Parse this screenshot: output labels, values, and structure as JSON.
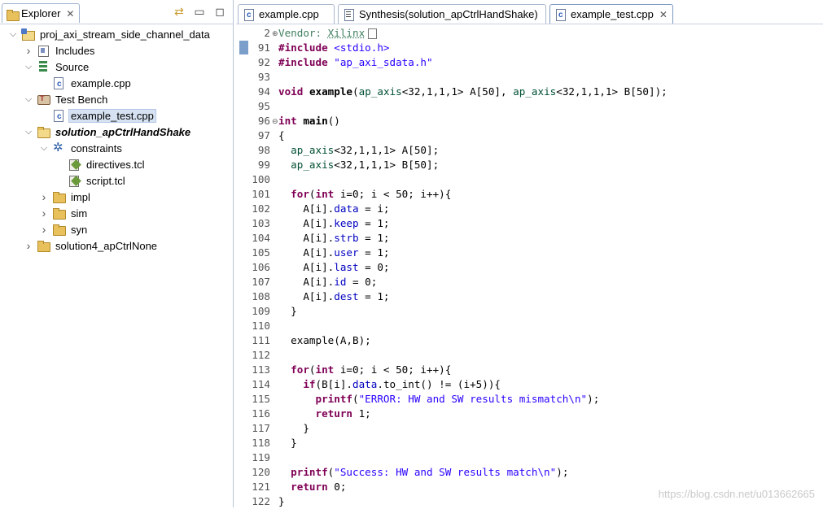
{
  "explorer": {
    "tab_label": "Explorer",
    "tree": [
      {
        "label": "proj_axi_stream_side_channel_data",
        "icon": "project-icon",
        "depth": 0,
        "expanded": true
      },
      {
        "label": "Includes",
        "icon": "includes-icon",
        "depth": 1,
        "expanded": false
      },
      {
        "label": "Source",
        "icon": "source-icon",
        "depth": 1,
        "expanded": true
      },
      {
        "label": "example.cpp",
        "icon": "cpp-file-icon",
        "depth": 2
      },
      {
        "label": "Test Bench",
        "icon": "test-bench-icon",
        "depth": 1,
        "expanded": true
      },
      {
        "label": "example_test.cpp",
        "icon": "cpp-file-icon",
        "depth": 2,
        "selected": true
      },
      {
        "label": "solution_apCtrlHandShake",
        "icon": "folder-icon",
        "depth": 1,
        "expanded": true,
        "active": true
      },
      {
        "label": "constraints",
        "icon": "gear-icon",
        "depth": 2,
        "expanded": true
      },
      {
        "label": "directives.tcl",
        "icon": "tcl-script-icon",
        "depth": 3
      },
      {
        "label": "script.tcl",
        "icon": "tcl-script-icon",
        "depth": 3
      },
      {
        "label": "impl",
        "icon": "folder-icon",
        "depth": 2,
        "expanded": false
      },
      {
        "label": "sim",
        "icon": "folder-icon",
        "depth": 2,
        "expanded": false
      },
      {
        "label": "syn",
        "icon": "folder-icon",
        "depth": 2,
        "expanded": false
      },
      {
        "label": "solution4_apCtrlNone",
        "icon": "folder-icon",
        "depth": 1,
        "expanded": false
      }
    ]
  },
  "editor": {
    "tabs": [
      {
        "label": "example.cpp",
        "icon": "cpp-file-icon",
        "active": false
      },
      {
        "label": "Synthesis(solution_apCtrlHandShake)",
        "icon": "report-icon",
        "active": false
      },
      {
        "label": "example_test.cpp",
        "icon": "cpp-file-icon",
        "active": true
      }
    ],
    "lines": [
      {
        "n": "2",
        "fold": "⊕",
        "tokens": [
          [
            "cmt",
            "Vendor: "
          ],
          [
            "cmt ref",
            "Xilinx"
          ]
        ],
        "box": true
      },
      {
        "n": "91",
        "tokens": [
          [
            "pp",
            "#include"
          ],
          [
            "",
            " "
          ],
          [
            "str",
            "<stdio.h>"
          ]
        ]
      },
      {
        "n": "92",
        "tokens": [
          [
            "pp",
            "#include"
          ],
          [
            "",
            " "
          ],
          [
            "str",
            "\"ap_axi_sdata.h\""
          ]
        ]
      },
      {
        "n": "93",
        "tokens": []
      },
      {
        "n": "94",
        "tokens": [
          [
            "kw",
            "void"
          ],
          [
            "",
            " "
          ],
          [
            "fn",
            "example"
          ],
          [
            "",
            "("
          ],
          [
            "ty",
            "ap_axis"
          ],
          [
            "",
            "<32,1,1,1> A[50], "
          ],
          [
            "ty",
            "ap_axis"
          ],
          [
            "",
            "<32,1,1,1> B[50]);"
          ]
        ]
      },
      {
        "n": "95",
        "tokens": []
      },
      {
        "n": "96",
        "fold": "⊖",
        "tokens": [
          [
            "kw",
            "int"
          ],
          [
            "",
            " "
          ],
          [
            "fn",
            "main"
          ],
          [
            "",
            "()"
          ]
        ]
      },
      {
        "n": "97",
        "tokens": [
          [
            "",
            "{"
          ]
        ]
      },
      {
        "n": "98",
        "tokens": [
          [
            "",
            "  "
          ],
          [
            "ty",
            "ap_axis"
          ],
          [
            "",
            "<32,1,1,1> A[50];"
          ]
        ]
      },
      {
        "n": "99",
        "tokens": [
          [
            "",
            "  "
          ],
          [
            "ty",
            "ap_axis"
          ],
          [
            "",
            "<32,1,1,1> B[50];"
          ]
        ]
      },
      {
        "n": "100",
        "tokens": []
      },
      {
        "n": "101",
        "tokens": [
          [
            "",
            "  "
          ],
          [
            "kw",
            "for"
          ],
          [
            "",
            "("
          ],
          [
            "kw",
            "int"
          ],
          [
            "",
            " i=0; i < 50; i++){"
          ]
        ]
      },
      {
        "n": "102",
        "tokens": [
          [
            "",
            "    A[i]."
          ],
          [
            "fld",
            "data"
          ],
          [
            "",
            " = i;"
          ]
        ]
      },
      {
        "n": "103",
        "tokens": [
          [
            "",
            "    A[i]."
          ],
          [
            "fld",
            "keep"
          ],
          [
            "",
            " = 1;"
          ]
        ]
      },
      {
        "n": "104",
        "tokens": [
          [
            "",
            "    A[i]."
          ],
          [
            "fld",
            "strb"
          ],
          [
            "",
            " = 1;"
          ]
        ]
      },
      {
        "n": "105",
        "tokens": [
          [
            "",
            "    A[i]."
          ],
          [
            "fld",
            "user"
          ],
          [
            "",
            " = 1;"
          ]
        ]
      },
      {
        "n": "106",
        "tokens": [
          [
            "",
            "    A[i]."
          ],
          [
            "fld",
            "last"
          ],
          [
            "",
            " = 0;"
          ]
        ]
      },
      {
        "n": "107",
        "tokens": [
          [
            "",
            "    A[i]."
          ],
          [
            "fld",
            "id"
          ],
          [
            "",
            " = 0;"
          ]
        ]
      },
      {
        "n": "108",
        "tokens": [
          [
            "",
            "    A[i]."
          ],
          [
            "fld",
            "dest"
          ],
          [
            "",
            " = 1;"
          ]
        ]
      },
      {
        "n": "109",
        "tokens": [
          [
            "",
            "  }"
          ]
        ]
      },
      {
        "n": "110",
        "tokens": []
      },
      {
        "n": "111",
        "tokens": [
          [
            "",
            "  example(A,B);"
          ]
        ]
      },
      {
        "n": "112",
        "tokens": []
      },
      {
        "n": "113",
        "tokens": [
          [
            "",
            "  "
          ],
          [
            "kw",
            "for"
          ],
          [
            "",
            "("
          ],
          [
            "kw",
            "int"
          ],
          [
            "",
            " i=0; i < 50; i++){"
          ]
        ]
      },
      {
        "n": "114",
        "tokens": [
          [
            "",
            "    "
          ],
          [
            "kw",
            "if"
          ],
          [
            "",
            "(B[i]."
          ],
          [
            "fld",
            "data"
          ],
          [
            "",
            ".to_int() != (i+5)){"
          ]
        ]
      },
      {
        "n": "115",
        "tokens": [
          [
            "",
            "      "
          ],
          [
            "kw",
            "printf"
          ],
          [
            "",
            "("
          ],
          [
            "str",
            "\"ERROR: HW and SW results mismatch\\n\""
          ],
          [
            "",
            ");"
          ]
        ]
      },
      {
        "n": "116",
        "tokens": [
          [
            "",
            "      "
          ],
          [
            "kw",
            "return"
          ],
          [
            "",
            " 1;"
          ]
        ]
      },
      {
        "n": "117",
        "tokens": [
          [
            "",
            "    }"
          ]
        ]
      },
      {
        "n": "118",
        "tokens": [
          [
            "",
            "  }"
          ]
        ]
      },
      {
        "n": "119",
        "tokens": []
      },
      {
        "n": "120",
        "tokens": [
          [
            "",
            "  "
          ],
          [
            "kw",
            "printf"
          ],
          [
            "",
            "("
          ],
          [
            "str",
            "\"Success: HW and SW results match\\n\""
          ],
          [
            "",
            ");"
          ]
        ]
      },
      {
        "n": "121",
        "tokens": [
          [
            "",
            "  "
          ],
          [
            "kw",
            "return"
          ],
          [
            "",
            " 0;"
          ]
        ]
      },
      {
        "n": "122",
        "tokens": [
          [
            "",
            "}"
          ]
        ]
      }
    ]
  },
  "watermark": "https://blog.csdn.net/u013662665"
}
